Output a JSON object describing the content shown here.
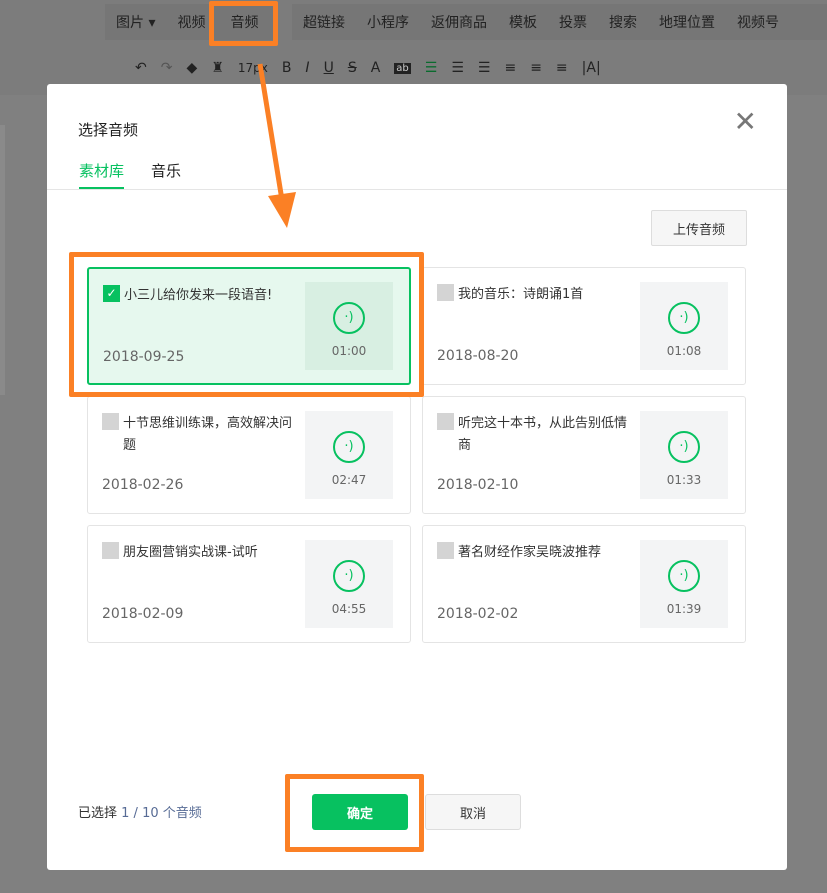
{
  "menu": [
    "图片 ▾",
    "视频",
    "音频",
    "超链接",
    "小程序",
    "返佣商品",
    "模板",
    "投票",
    "搜索",
    "地理位置",
    "视频号"
  ],
  "toolbar": {
    "font_size": "17px"
  },
  "dialog": {
    "title": "选择音频",
    "tabs": [
      "素材库",
      "音乐"
    ],
    "upload_label": "上传音频",
    "items": [
      {
        "title": "小三儿给你发来一段语音!",
        "date": "2018-09-25",
        "duration": "01:00",
        "selected": true
      },
      {
        "title": "我的音乐：诗朗诵1首",
        "date": "2018-08-20",
        "duration": "01:08",
        "selected": false
      },
      {
        "title": "十节思维训练课，高效解决问题",
        "date": "2018-02-26",
        "duration": "02:47",
        "selected": false
      },
      {
        "title": "听完这十本书，从此告别低情商",
        "date": "2018-02-10",
        "duration": "01:33",
        "selected": false
      },
      {
        "title": "朋友圈营销实战课-试听",
        "date": "2018-02-09",
        "duration": "04:55",
        "selected": false
      },
      {
        "title": "著名财经作家吴晓波推荐",
        "date": "2018-02-02",
        "duration": "01:39",
        "selected": false
      }
    ],
    "count_prefix": "已选择",
    "count_value": "1 / 10 个音频",
    "confirm_label": "确定",
    "cancel_label": "取消"
  },
  "colors": {
    "accent": "#07c160",
    "annotation": "#fb8025"
  }
}
